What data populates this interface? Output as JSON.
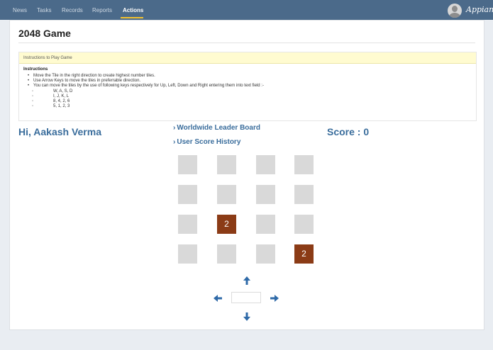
{
  "nav": {
    "items": [
      "News",
      "Tasks",
      "Records",
      "Reports",
      "Actions"
    ],
    "active": "Actions",
    "brand": "Appian",
    "accent_color": "#f2c12e",
    "bar_color": "#4b6a8a"
  },
  "page": {
    "title": "2048 Game"
  },
  "instructions": {
    "header": "Instructions to Play Game",
    "title": "Instructions",
    "bullets": [
      "Move the Tile in the right direction to create highest number tiles.",
      "Use Arrow Keys to move the tiles in preferrable direction.",
      "You can move the tiles by the use of following keys respectively for Up, Left, Down and Right entering them into text field :-"
    ],
    "key_sets": [
      "W,   A,   S,   D",
      "I,    J,    K,   L",
      "8,   4,    2,   6",
      "5,   1,    2,   3"
    ]
  },
  "game": {
    "greeting": "Hi, Aakash Verma",
    "leaderboard_link": "Worldwide Leader Board",
    "history_link": "User Score History",
    "score_label": "Score : 0",
    "grid": [
      [
        "",
        "",
        "",
        ""
      ],
      [
        "",
        "",
        "",
        ""
      ],
      [
        "",
        "2",
        "",
        ""
      ],
      [
        "",
        "",
        "",
        "2"
      ]
    ],
    "tile_color": "#8b3b16",
    "empty_color": "#d9d9d9",
    "move_input_value": ""
  },
  "icons": {
    "up": "arrow-up-icon",
    "down": "arrow-down-icon",
    "left": "arrow-left-icon",
    "right": "arrow-right-icon",
    "link_chevron": "chevron-right-icon"
  }
}
